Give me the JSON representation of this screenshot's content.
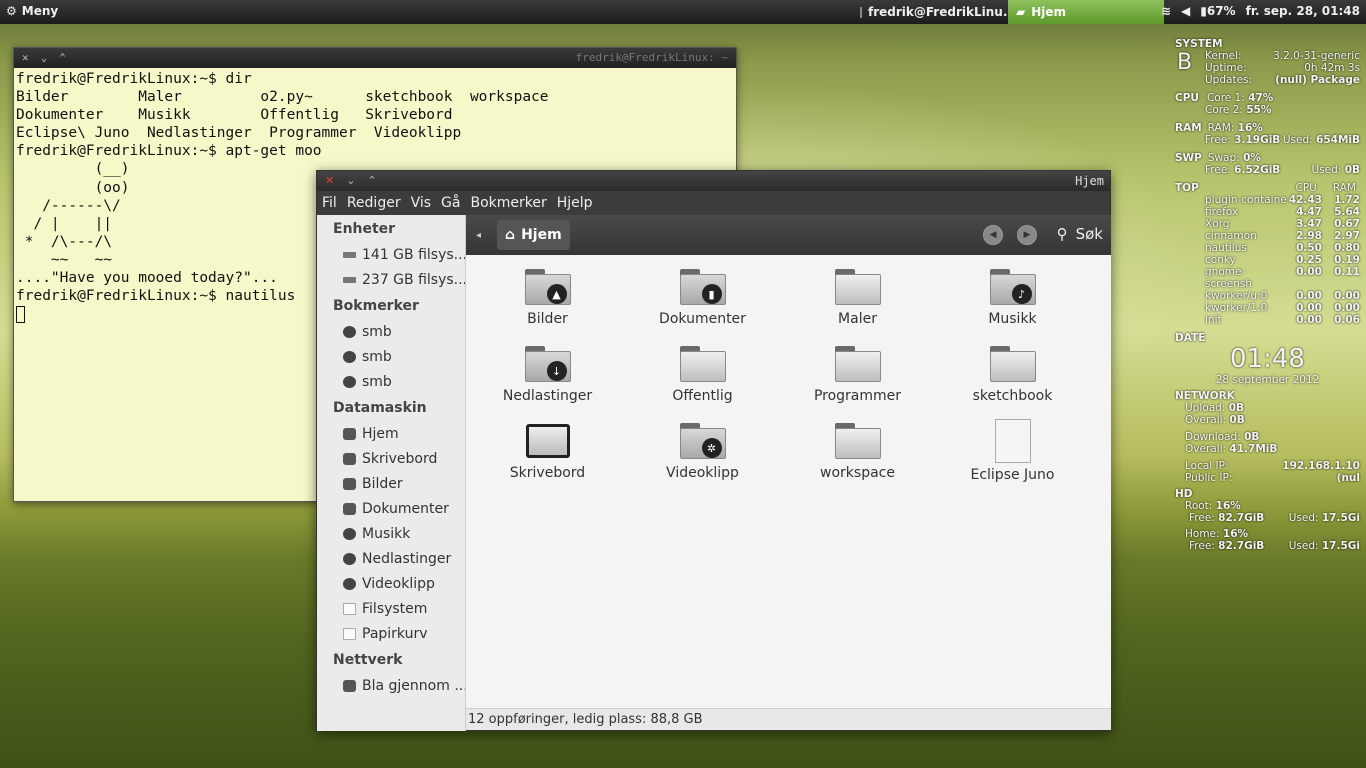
{
  "panel": {
    "menu_label": "Meny",
    "tasks": [
      "fredrik@FredrikLinu...",
      "Hjem"
    ],
    "battery": "67%",
    "clock": "fr. sep. 28, 01:48"
  },
  "terminal": {
    "title": "fredrik@FredrikLinux: ~",
    "lines": [
      "fredrik@FredrikLinux:~$ dir",
      "Bilder        Maler         o2.py~      sketchbook  workspace",
      "Dokumenter    Musikk        Offentlig   Skrivebord",
      "Eclipse\\ Juno  Nedlastinger  Programmer  Videoklipp",
      "fredrik@FredrikLinux:~$ apt-get moo",
      "         (__)",
      "         (oo)",
      "   /------\\/",
      "  / |    ||",
      " *  /\\---/\\",
      "    ~~   ~~",
      "....\"Have you mooed today?\"...",
      "fredrik@FredrikLinux:~$ nautilus"
    ]
  },
  "nautilus": {
    "title": "Hjem",
    "menu": [
      "Fil",
      "Rediger",
      "Vis",
      "Gå",
      "Bokmerker",
      "Hjelp"
    ],
    "sidebar": [
      {
        "header": "Enheter",
        "items": [
          "141 GB filsys...",
          "237 GB filsys..."
        ]
      },
      {
        "header": "Bokmerker",
        "items": [
          "smb",
          "smb",
          "smb"
        ]
      },
      {
        "header": "Datamaskin",
        "items": [
          "Hjem",
          "Skrivebord",
          "Bilder",
          "Dokumenter",
          "Musikk",
          "Nedlastinger",
          "Videoklipp",
          "Filsystem",
          "Papirkurv"
        ]
      },
      {
        "header": "Nettverk",
        "items": [
          "Bla gjennom ..."
        ]
      }
    ],
    "location": "Hjem",
    "search_label": "Søk",
    "files": [
      "Bilder",
      "Dokumenter",
      "Maler",
      "Musikk",
      "Nedlastinger",
      "Offentlig",
      "Programmer",
      "sketchbook",
      "Skrivebord",
      "Videoklipp",
      "workspace",
      "Eclipse Juno"
    ],
    "status": "12 oppføringer, ledig plass: 88,8 GB"
  },
  "conky": {
    "system_h": "SYSTEM",
    "kernel_l": "Kernel:",
    "kernel_v": "3.2.0-31-generic",
    "uptime_l": "Uptime:",
    "uptime_v": "0h 42m 3s",
    "updates_l": "Updates:",
    "updates_v": "(null) Package",
    "logo": "B",
    "cpu_h": "CPU",
    "core1_l": "Core 1:",
    "core1_v": "47%",
    "core2_l": "Core 2:",
    "core2_v": "55%",
    "ram_h": "RAM",
    "ram_l": "RAM:",
    "ram_v": "16%",
    "ram_free_l": "Free:",
    "ram_free_v": "3.19GiB",
    "ram_used_l": "Used:",
    "ram_used_v": "654MiB",
    "swp_h": "SWP",
    "swap_l": "Swap:",
    "swap_v": "0%",
    "swp_free_l": "Free:",
    "swp_free_v": "6.52GiB",
    "swp_used_l": "Used:",
    "swp_used_v": "0B",
    "top_h": "TOP",
    "top_cpu": "CPU",
    "top_ram": "RAM",
    "top": [
      [
        "plugin-containe",
        "42.43",
        "1.72"
      ],
      [
        "firefox",
        "4.47",
        "5.64"
      ],
      [
        "Xorg",
        "3.47",
        "0.67"
      ],
      [
        "cinnamon",
        "2.98",
        "2.97"
      ],
      [
        "nautilus",
        "0.50",
        "0.80"
      ],
      [
        "conky",
        "0.25",
        "0.19"
      ],
      [
        "gnome-screensh",
        "0.00",
        "0.11"
      ],
      [
        "kworker/u:0",
        "0.00",
        "0.00"
      ],
      [
        "kworker/1:0",
        "0.00",
        "0.00"
      ],
      [
        "init",
        "0.00",
        "0.06"
      ]
    ],
    "date_h": "DATE",
    "time": "01:48",
    "date": "28 september 2012",
    "net_h": "NETWORK",
    "upload_l": "Upload:",
    "upload_v": "0B",
    "overall_l": "Overall:",
    "overall_up_v": "0B",
    "download_l": "Download:",
    "download_v": "0B",
    "overall_down_v": "41.7MiB",
    "localip_l": "Local IP:",
    "localip_v": "192.168.1.10",
    "publicip_l": "Public IP:",
    "publicip_v": "(nul",
    "hd_h": "HD",
    "root_l": "Root:",
    "root_v": "16%",
    "hd_free_l": "Free:",
    "root_free_v": "82.7GiB",
    "hd_used_l": "Used:",
    "root_used_v": "17.5Gi",
    "home_l": "Home:",
    "home_v": "16%",
    "home_free_v": "82.7GiB",
    "home_used_v": "17.5Gi"
  }
}
